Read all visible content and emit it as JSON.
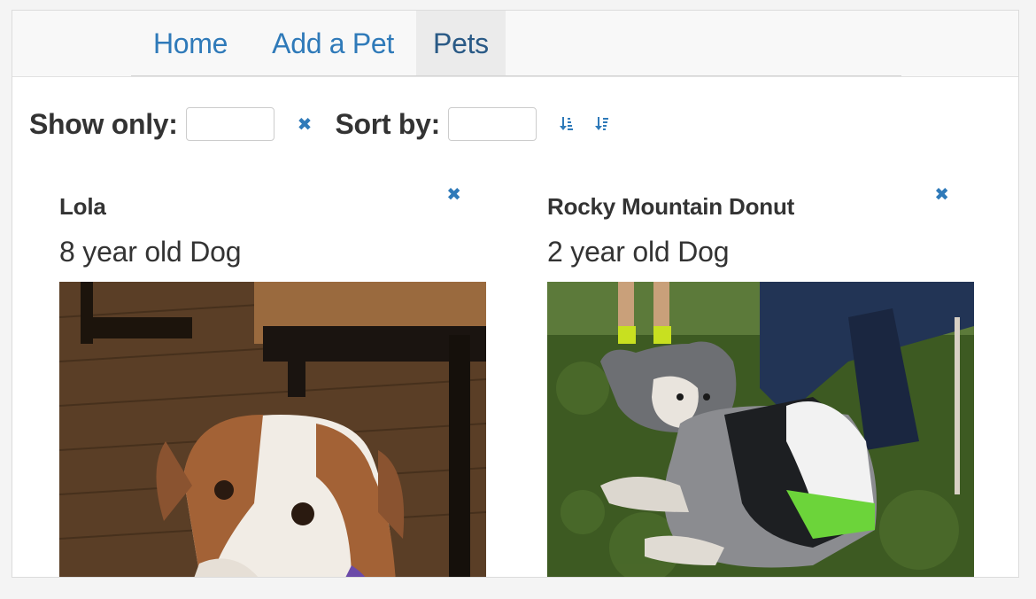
{
  "nav": {
    "tabs": [
      {
        "label": "Home"
      },
      {
        "label": "Add a Pet"
      },
      {
        "label": "Pets"
      }
    ],
    "active_tab": "Pets"
  },
  "filters": {
    "show_only_label": "Show only:",
    "show_only_value": "",
    "clear_icon": "close-icon",
    "sort_by_label": "Sort by:",
    "sort_by_value": "",
    "sort_asc_icon": "sort-ascending-icon",
    "sort_desc_icon": "sort-descending-icon"
  },
  "pets": [
    {
      "name": "Lola",
      "description": "8 year old Dog",
      "remove_icon": "close-icon",
      "photo": "photo of a brown and white dog on a wood floor"
    },
    {
      "name": "Rocky Mountain Donut",
      "description": "2 year old Dog",
      "remove_icon": "close-icon",
      "photo": "photo of a merle dog in a jersey lying on grass"
    }
  ],
  "colors": {
    "link": "#2f7ab9",
    "active_tab_bg": "#ebebeb",
    "navbar_bg": "#f8f8f8",
    "text": "#333333"
  }
}
